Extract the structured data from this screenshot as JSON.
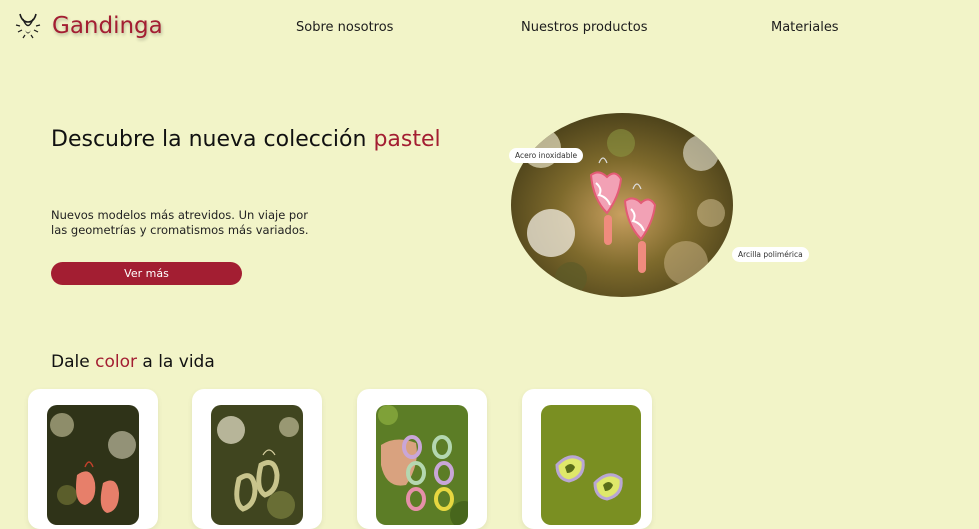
{
  "brand": {
    "name": "Gandinga",
    "icon": "bull-necklace-logo-icon"
  },
  "nav": {
    "items": [
      {
        "label": "Sobre nosotros"
      },
      {
        "label": "Nuestros productos"
      },
      {
        "label": "Materiales"
      }
    ]
  },
  "hero": {
    "title_prefix": "Descubre la nueva colección",
    "title_accent": "pastel",
    "subtitle": "Nuevos modelos más atrevidos. Un viaje por las geometrías y cromatismos más variados.",
    "cta_label": "Ver más",
    "tags": [
      "Acero inoxidable",
      "Arcilla polimérica"
    ]
  },
  "section": {
    "title_prefix": "Dale",
    "title_accent": "color",
    "title_suffix": "a la vida"
  },
  "colors": {
    "background": "#f2f4c8",
    "accent": "#a31e32",
    "card": "#ffffff"
  }
}
